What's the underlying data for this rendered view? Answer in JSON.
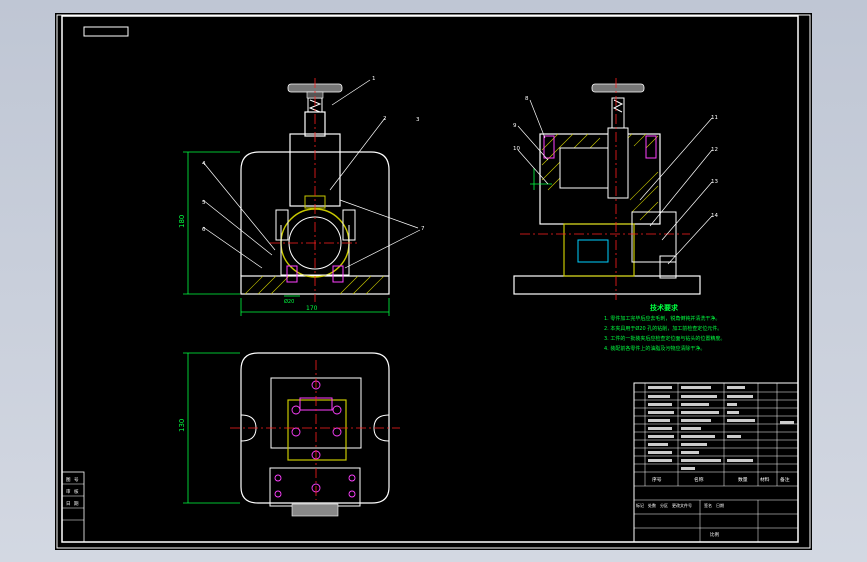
{
  "window": {
    "kind": "CAD drawing viewport"
  },
  "colors": {
    "background": "#000000",
    "frame": "#ffffff",
    "part_outline": "#ffffff",
    "hidden_gray": "#9a9a9a",
    "dimension_green": "#00ff40",
    "hatch_yellow": "#c8c800",
    "center_red": "#ff2020",
    "leader_white": "#ffffff",
    "accent_cyan": "#00d0ff",
    "accent_magenta": "#ff40ff"
  },
  "balloons_front": [
    "1",
    "2",
    "3",
    "4",
    "5",
    "6",
    "7"
  ],
  "balloons_side": [
    "8",
    "9",
    "10",
    "11",
    "12",
    "13",
    "14"
  ],
  "dimensions": {
    "front_height": "180",
    "front_width": "170",
    "front_small": "Ø20",
    "plan_height": "130"
  },
  "technical_requirements": {
    "title": "技术要求",
    "items": [
      "1. 零件加工完毕后应去毛刺，锐角倒钝并清洗干净。",
      "2. 本夹具用于Ø20 孔的钻削，加工前检查定位元件。",
      "3. 工件的一批装夹后应检查定位面与钻头的位置精度。",
      "4. 装配前各零件上的油脂及污物应清除干净。"
    ]
  },
  "title_block": {
    "header": [
      "序号",
      "名称",
      "数量",
      "材料",
      "备注"
    ],
    "bottom_row": [
      "标记",
      "处数",
      "分区",
      "更改文件号",
      "签名",
      "日期"
    ],
    "scale_label": "比例"
  },
  "left_strip": [
    "图",
    "号",
    "审",
    "核",
    "日",
    "期"
  ]
}
